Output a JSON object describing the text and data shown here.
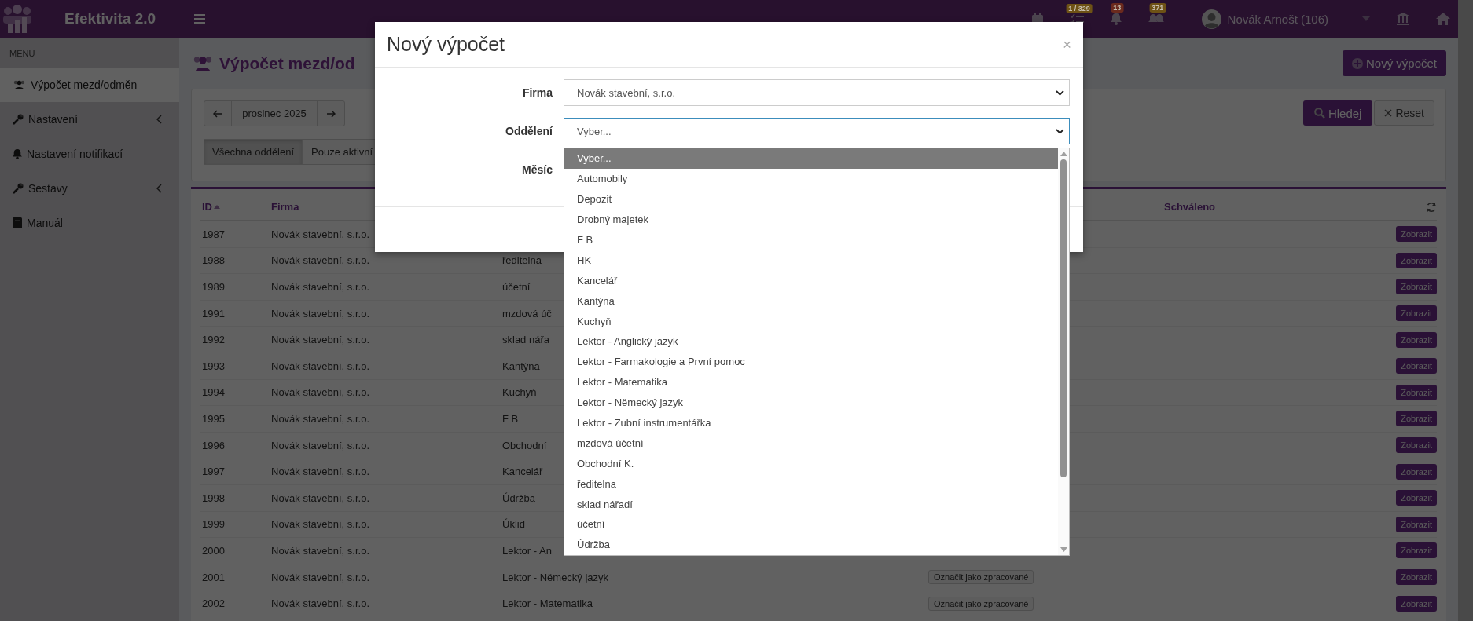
{
  "top_bar": {
    "app_name": "Efektivita 2.0",
    "badges": [
      {
        "kind": "tasks",
        "text": "1 / 329",
        "color": "#6e5215"
      },
      {
        "kind": "bell",
        "text": "13",
        "color": "#6b2a1e"
      },
      {
        "kind": "chat",
        "text": "371",
        "color": "#6e5215"
      }
    ],
    "user": "Novák Arnošt (106)"
  },
  "sidebar": {
    "heading": "MENU",
    "items": [
      {
        "kind": "people",
        "label": "Výpočet mezd/odměn",
        "selected": true,
        "expandable": false
      },
      {
        "kind": "wrench",
        "label": "Nastavení",
        "selected": false,
        "expandable": true
      },
      {
        "kind": "bell",
        "label": "Nastavení notifikací",
        "selected": false,
        "expandable": false
      },
      {
        "kind": "wrench",
        "label": "Sestavy",
        "selected": false,
        "expandable": true
      },
      {
        "kind": "book",
        "label": "Manuál",
        "selected": false,
        "expandable": false
      }
    ]
  },
  "page": {
    "title": "Výpočet mezd/od",
    "new_button": "Nový výpočet",
    "month": "prosinec 2025",
    "filters": [
      {
        "label": "Všechna oddělení",
        "selected": true
      },
      {
        "label": "Pouze aktivní",
        "selected": false
      }
    ],
    "search_button": "Hledej",
    "reset_button": "Reset"
  },
  "table": {
    "columns": {
      "id": "ID",
      "firma": "Firma",
      "approved": "Schváleno"
    },
    "rows": [
      {
        "id": "1987",
        "firma": "Novák stavební, s.r.o.",
        "view_button": "Zobrazit"
      },
      {
        "id": "1988",
        "firma": "Novák stavební, s.r.o.",
        "department": "ředitelna",
        "view_button": "Zobrazit"
      },
      {
        "id": "1989",
        "firma": "Novák stavební, s.r.o.",
        "department": "účetní",
        "view_button": "Zobrazit"
      },
      {
        "id": "1991",
        "firma": "Novák stavební, s.r.o.",
        "department": "mzdová úč",
        "view_button": "Zobrazit"
      },
      {
        "id": "1992",
        "firma": "Novák stavební, s.r.o.",
        "department": "sklad nářa",
        "view_button": "Zobrazit"
      },
      {
        "id": "1993",
        "firma": "Novák stavební, s.r.o.",
        "department": "Kantýna",
        "view_button": "Zobrazit"
      },
      {
        "id": "1994",
        "firma": "Novák stavební, s.r.o.",
        "department": "Kuchyň",
        "view_button": "Zobrazit"
      },
      {
        "id": "1995",
        "firma": "Novák stavební, s.r.o.",
        "department": "F B",
        "view_button": "Zobrazit"
      },
      {
        "id": "1996",
        "firma": "Novák stavební, s.r.o.",
        "department": "Obchodní",
        "view_button": "Zobrazit"
      },
      {
        "id": "1997",
        "firma": "Novák stavební, s.r.o.",
        "department": "Kancelář",
        "view_button": "Zobrazit"
      },
      {
        "id": "1998",
        "firma": "Novák stavební, s.r.o.",
        "department": "Údržba",
        "view_button": "Zobrazit"
      },
      {
        "id": "1999",
        "firma": "Novák stavební, s.r.o.",
        "department": "Úklid",
        "view_button": "Zobrazit"
      },
      {
        "id": "2000",
        "firma": "Novák stavební, s.r.o.",
        "department": "Lektor - An",
        "view_button": "Zobrazit"
      },
      {
        "id": "2001",
        "firma": "Novák stavební, s.r.o.",
        "department": "Lektor - Německý jazyk",
        "mark_button": "Označit jako zpracované",
        "view_button": "Zobrazit"
      },
      {
        "id": "2002",
        "firma": "Novák stavební, s.r.o.",
        "department": "Lektor - Matematika",
        "mark_button": "Označit jako zpracované",
        "view_button": "Zobrazit"
      }
    ]
  },
  "modal": {
    "title": "Nový výpočet",
    "close": "×",
    "fields": [
      {
        "label": "Firma",
        "value": "Novák stavební, s.r.o.",
        "focused": false
      },
      {
        "label": "Oddělení",
        "value": "Vyber...",
        "focused": true
      },
      {
        "label": "Měsíc"
      }
    ],
    "dropdown": {
      "options": [
        {
          "label": "Vyber...",
          "selected": true
        },
        {
          "label": "Automobily",
          "selected": false
        },
        {
          "label": "Depozit",
          "selected": false
        },
        {
          "label": "Drobný majetek",
          "selected": false
        },
        {
          "label": "F B",
          "selected": false
        },
        {
          "label": "HK",
          "selected": false
        },
        {
          "label": "Kancelář",
          "selected": false
        },
        {
          "label": "Kantýna",
          "selected": false
        },
        {
          "label": "Kuchyň",
          "selected": false
        },
        {
          "label": "Lektor - Anglický jazyk",
          "selected": false
        },
        {
          "label": "Lektor - Farmakologie a První pomoc",
          "selected": false
        },
        {
          "label": "Lektor - Matematika",
          "selected": false
        },
        {
          "label": "Lektor - Německý jazyk",
          "selected": false
        },
        {
          "label": "Lektor - Zubní instrumentářka",
          "selected": false
        },
        {
          "label": "mzdová účetní",
          "selected": false
        },
        {
          "label": "Obchodní K.",
          "selected": false
        },
        {
          "label": "ředitelna",
          "selected": false
        },
        {
          "label": "sklad nářadí",
          "selected": false
        },
        {
          "label": "účetní",
          "selected": false
        },
        {
          "label": "Údržba",
          "selected": false
        }
      ]
    }
  }
}
